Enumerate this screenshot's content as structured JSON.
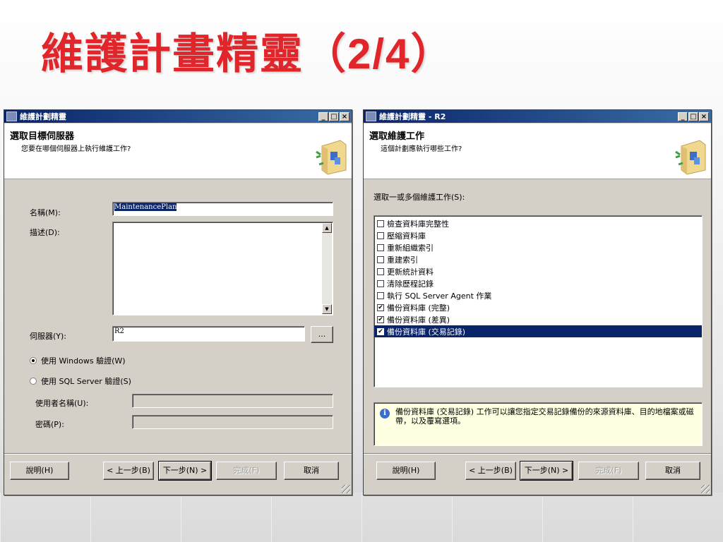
{
  "slide": {
    "title": "維護計畫精靈（",
    "title_frac": "2/4",
    "title_end": "）"
  },
  "left_window": {
    "title": "維護計劃精靈",
    "header_title": "選取目標伺服器",
    "header_subtitle": "您要在哪個伺服器上執行維護工作?",
    "name_label": "名稱(M):",
    "name_value": "MaintenancePlan",
    "description_label": "描述(D):",
    "description_value": "",
    "server_label": "伺服器(Y):",
    "server_value": "R2",
    "browse_label": "...",
    "auth_windows": "使用 Windows 驗證(W)",
    "auth_sql": "使用 SQL Server 驗證(S)",
    "username_label": "使用者名稱(U):",
    "password_label": "密碼(P):",
    "buttons": {
      "help": "說明(H)",
      "back": "< 上一步(B)",
      "next": "下一步(N) >",
      "finish": "完成(F)",
      "cancel": "取消"
    }
  },
  "right_window": {
    "title": "維護計劃精靈 - R2",
    "header_title": "選取維護工作",
    "header_subtitle": "這個計劃應執行哪些工作?",
    "list_label": "選取一或多個維護工作(S):",
    "tasks": [
      {
        "label": "檢查資料庫完整性",
        "checked": false,
        "selected": false
      },
      {
        "label": "壓縮資料庫",
        "checked": false,
        "selected": false
      },
      {
        "label": "重新組織索引",
        "checked": false,
        "selected": false
      },
      {
        "label": "重建索引",
        "checked": false,
        "selected": false
      },
      {
        "label": "更新統計資料",
        "checked": false,
        "selected": false
      },
      {
        "label": "清除歷程記錄",
        "checked": false,
        "selected": false
      },
      {
        "label": "執行 SQL Server Agent 作業",
        "checked": false,
        "selected": false
      },
      {
        "label": "備份資料庫 (完整)",
        "checked": true,
        "selected": false
      },
      {
        "label": "備份資料庫 (差異)",
        "checked": true,
        "selected": false
      },
      {
        "label": "備份資料庫 (交易記錄)",
        "checked": true,
        "selected": true
      }
    ],
    "info_text": "備份資料庫 (交易記錄) 工作可以讓您指定交易記錄備份的來源資料庫、目的地檔案或磁帶，以及覆寫選項。",
    "buttons": {
      "help": "說明(H)",
      "back": "< 上一步(B)",
      "next": "下一步(N) >",
      "finish": "完成(F)",
      "cancel": "取消"
    }
  },
  "icons": {
    "wizard": "wizard-folder-icon",
    "info": "info-icon",
    "app": "app-icon"
  }
}
